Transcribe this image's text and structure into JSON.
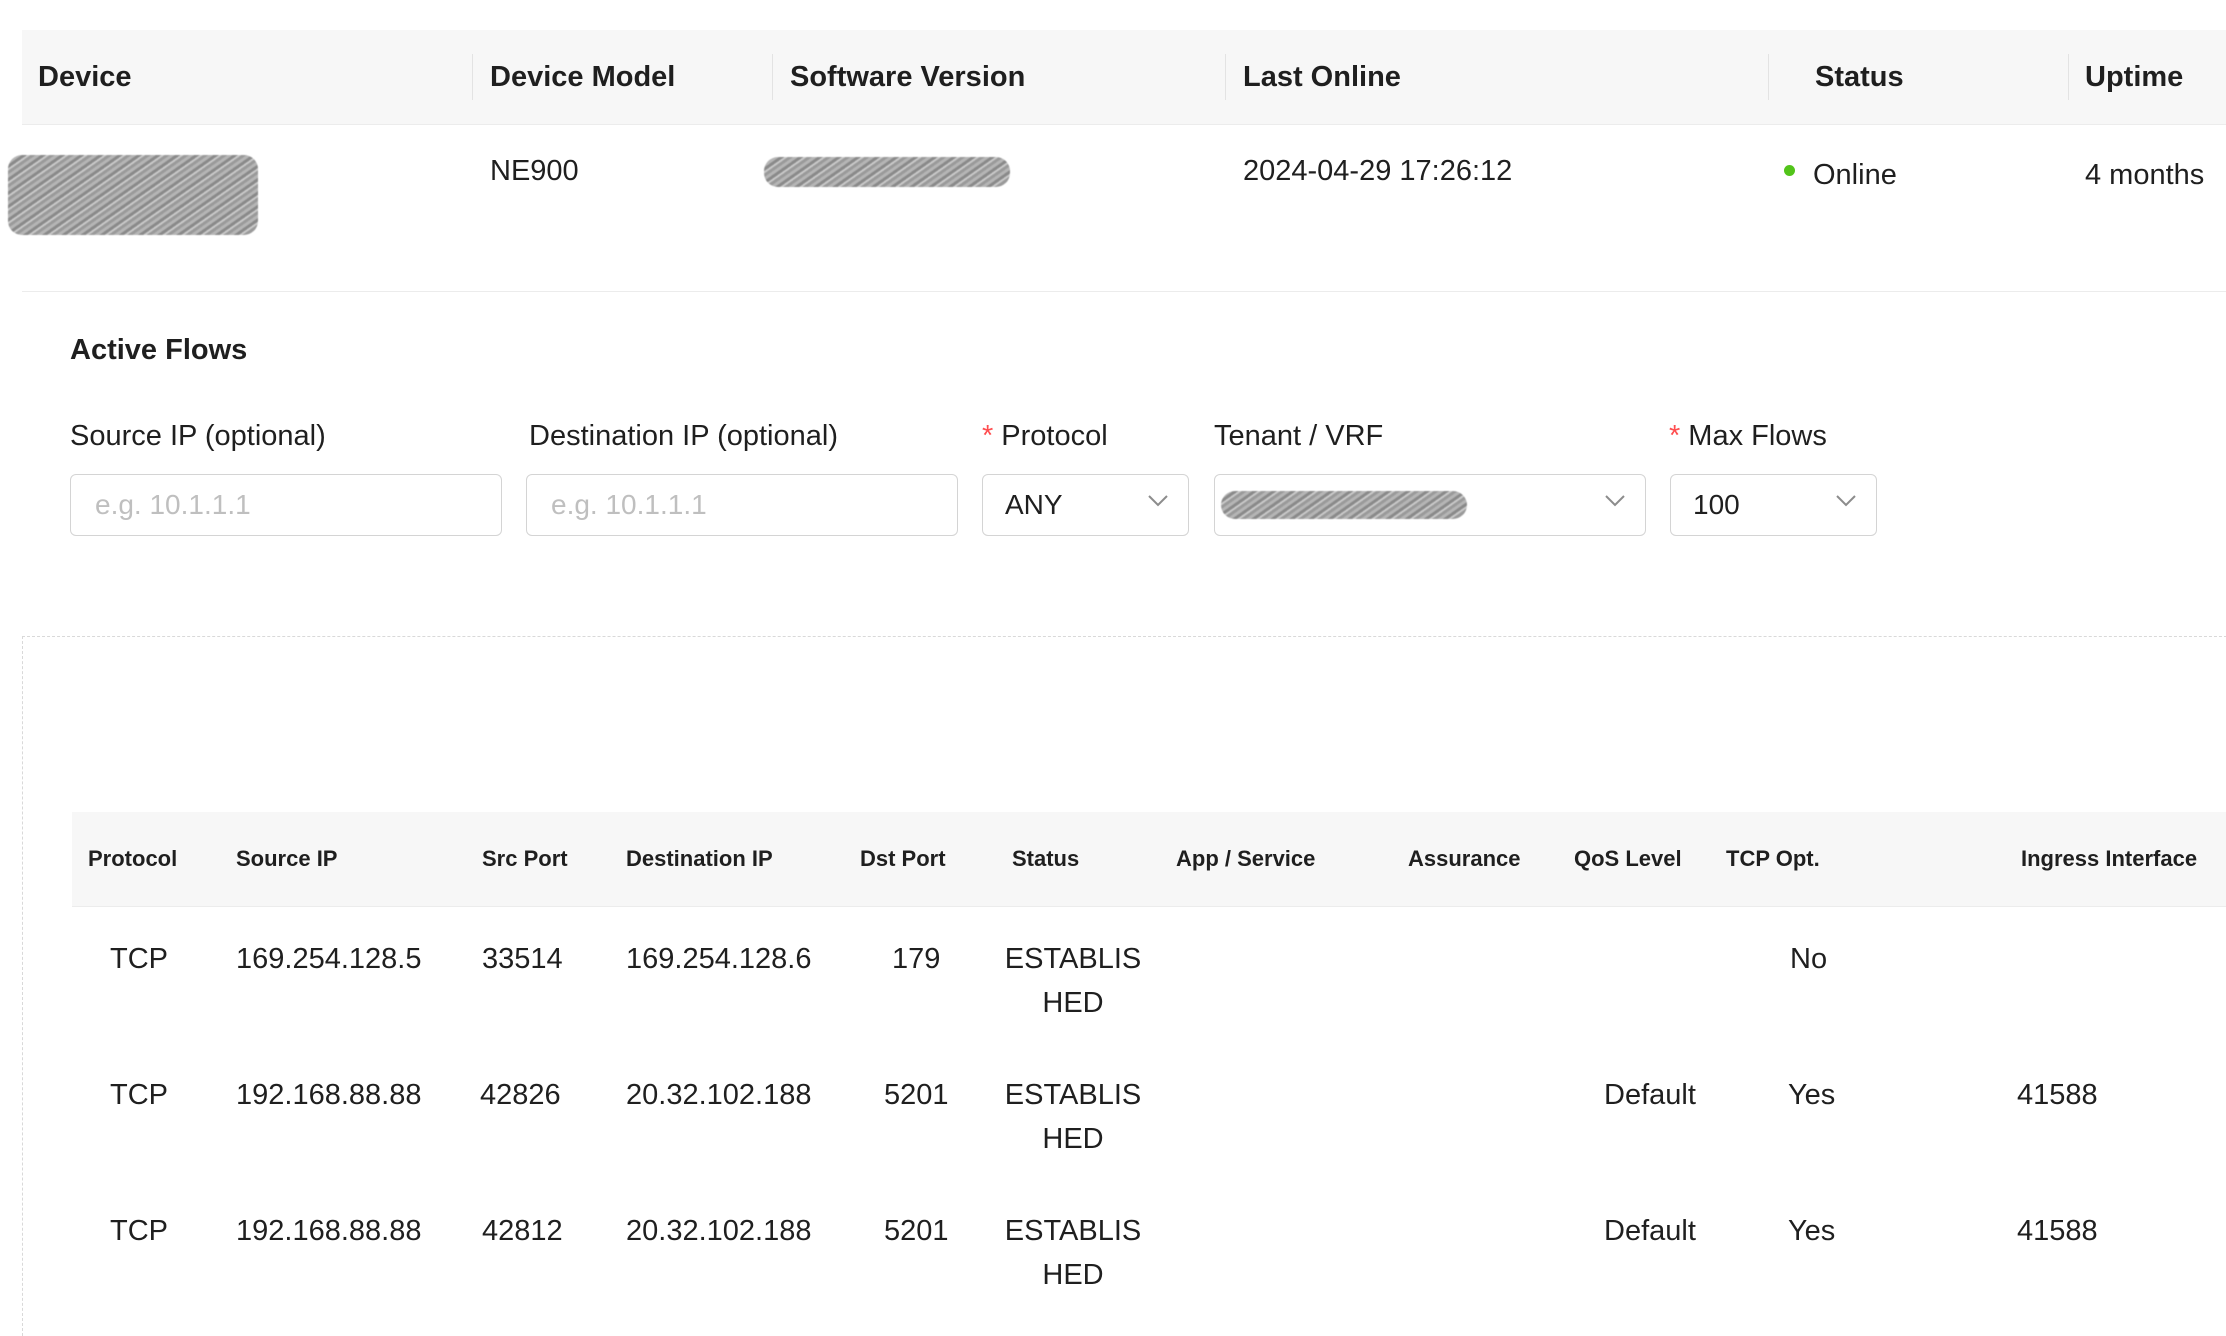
{
  "device_table": {
    "headers": [
      "Device",
      "Device Model",
      "Software Version",
      "Last Online",
      "Status",
      "Uptime"
    ],
    "row": {
      "device": "",
      "model": "NE900",
      "software_version": "",
      "last_online": "2024-04-29 17:26:12",
      "status": "Online",
      "uptime": "4 months"
    },
    "status_color": "#52c41a"
  },
  "active_flows": {
    "title": "Active Flows",
    "source_ip": {
      "label": "Source IP (optional)",
      "placeholder": "e.g. 10.1.1.1",
      "value": ""
    },
    "destination_ip": {
      "label": "Destination IP (optional)",
      "placeholder": "e.g. 10.1.1.1",
      "value": ""
    },
    "protocol": {
      "label": "Protocol",
      "required": true,
      "value": "ANY"
    },
    "tenant_vrf": {
      "label": "Tenant / VRF",
      "value": ""
    },
    "max_flows": {
      "label": "Max Flows",
      "required": true,
      "value": "100"
    },
    "required_mark": "*"
  },
  "flow_table": {
    "headers": [
      "Protocol",
      "Source IP",
      "Src Port",
      "Destination IP",
      "Dst Port",
      "Status",
      "App / Service",
      "Assurance",
      "QoS Level",
      "TCP Opt.",
      "Ingress Interface"
    ],
    "rows": [
      {
        "protocol": "TCP",
        "source_ip": "169.254.128.5",
        "src_port": "33514",
        "destination_ip": "169.254.128.6",
        "dst_port": "179",
        "status": "ESTABLISHED",
        "app": "",
        "assurance": "",
        "qos": "",
        "tcp_opt": "No",
        "ingress": ""
      },
      {
        "protocol": "TCP",
        "source_ip": "192.168.88.88",
        "src_port": "42826",
        "destination_ip": "20.32.102.188",
        "dst_port": "5201",
        "status": "ESTABLISHED",
        "app": "",
        "assurance": "",
        "qos": "Default",
        "tcp_opt": "Yes",
        "ingress": "41588"
      },
      {
        "protocol": "TCP",
        "source_ip": "192.168.88.88",
        "src_port": "42812",
        "destination_ip": "20.32.102.188",
        "dst_port": "5201",
        "status": "ESTABLISHED",
        "app": "",
        "assurance": "",
        "qos": "Default",
        "tcp_opt": "Yes",
        "ingress": "41588"
      }
    ]
  },
  "icons": {
    "select_arrow": "chevron-down-icon",
    "status_dot": "status-dot-icon"
  }
}
